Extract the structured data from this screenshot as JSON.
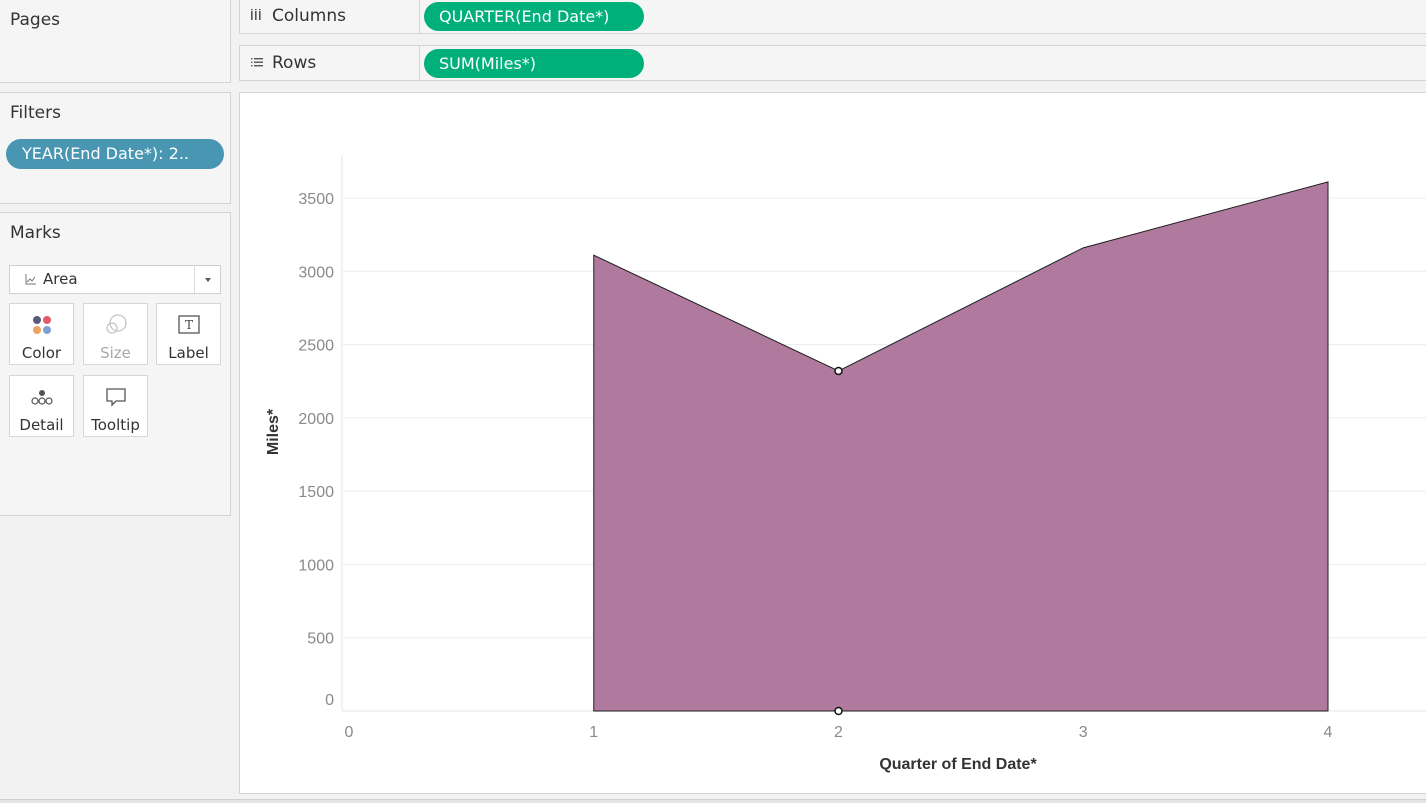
{
  "pages": {
    "title": "Pages"
  },
  "filters": {
    "title": "Filters",
    "pill_label": "YEAR(End Date*): 2.."
  },
  "marks": {
    "title": "Marks",
    "mark_type": "Area",
    "buttons": {
      "color": "Color",
      "size": "Size",
      "label": "Label",
      "detail": "Detail",
      "tooltip": "Tooltip"
    },
    "label_icon_glyph": "T"
  },
  "shelves": {
    "columns": {
      "label": "Columns",
      "pill": "QUARTER(End Date*)"
    },
    "rows": {
      "label": "Rows",
      "pill": "SUM(Miles*)"
    }
  },
  "colors": {
    "area_fill": "#b07a9f",
    "area_stroke": "#1e1e1e",
    "columns_pill": "#00b07a",
    "filter_pill": "#4996b2",
    "gridline": "#ececec",
    "tick_text": "#8a8a8a"
  },
  "chart_data": {
    "type": "area",
    "xlabel": "Quarter of End Date*",
    "ylabel": "Miles*",
    "x_ticks": [
      0,
      1,
      2,
      3,
      4
    ],
    "y_ticks": [
      0,
      500,
      1000,
      1500,
      2000,
      2500,
      3000,
      3500
    ],
    "xlim": [
      0,
      4
    ],
    "ylim": [
      0,
      3500
    ],
    "grid": true,
    "series": [
      {
        "x": [
          1,
          2,
          3,
          4
        ],
        "values": [
          3110,
          2320,
          3160,
          3610
        ]
      }
    ],
    "highlighted_point": {
      "x": 2,
      "y": 2320
    }
  }
}
